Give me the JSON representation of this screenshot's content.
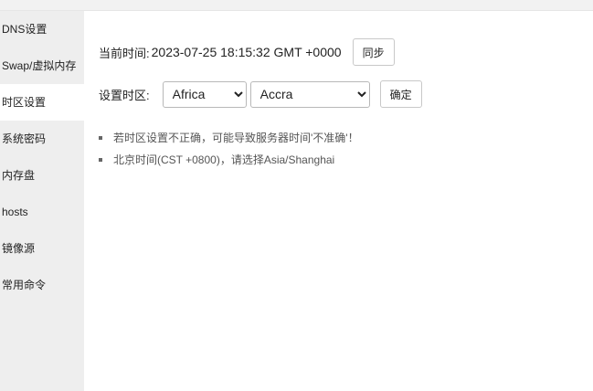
{
  "sidebar": {
    "items": [
      {
        "label": "DNS设置"
      },
      {
        "label": "Swap/虚拟内存"
      },
      {
        "label": "时区设置"
      },
      {
        "label": "系统密码"
      },
      {
        "label": "内存盘"
      },
      {
        "label": "hosts"
      },
      {
        "label": "镜像源"
      },
      {
        "label": "常用命令"
      }
    ],
    "active_index": 2
  },
  "time_row": {
    "label": "当前时间:",
    "value": "2023-07-25 18:15:32 GMT +0000",
    "sync_label": "同步"
  },
  "zone_row": {
    "label": "设置时区:",
    "region_selected": "Africa",
    "city_selected": "Accra",
    "confirm_label": "确定"
  },
  "tips": [
    "若时区设置不正确，可能导致服务器时间'不准确'！",
    "北京时间(CST +0800)，请选择Asia/Shanghai"
  ]
}
